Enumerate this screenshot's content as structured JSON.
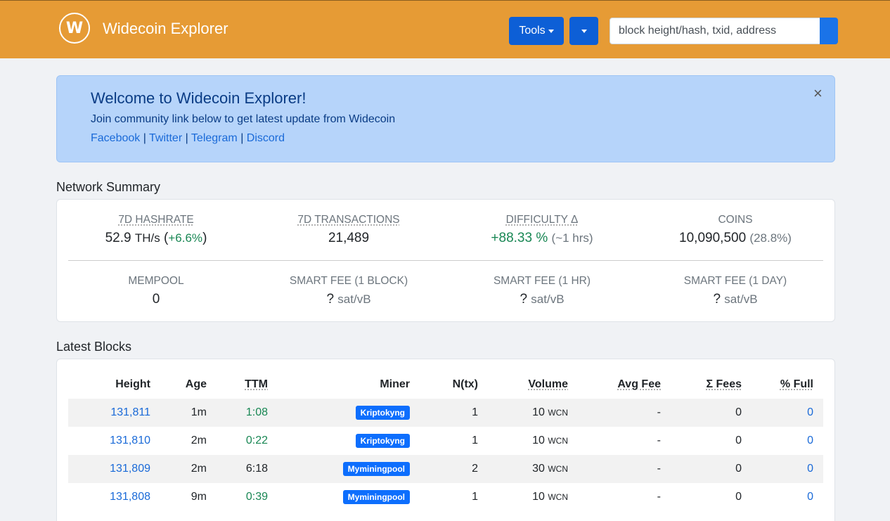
{
  "nav": {
    "logo_letter": "W",
    "brand": "Widecoin Explorer",
    "tools_label": "Tools",
    "search_placeholder": "block height/hash, txid, address"
  },
  "alert": {
    "title": "Welcome to Widecoin Explorer!",
    "text": "Join community link below to get latest update from Widecoin",
    "links": [
      "Facebook",
      "Twitter",
      "Telegram",
      "Discord"
    ],
    "separator": "|",
    "close": "×"
  },
  "network_summary": {
    "title": "Network Summary",
    "hashrate": {
      "label": "7D HASHRATE",
      "value": "52.9",
      "unit": "TH/s",
      "change": "+6.6%"
    },
    "transactions": {
      "label": "7D TRANSACTIONS",
      "value": "21,489"
    },
    "difficulty": {
      "label": "DIFFICULTY Δ",
      "value": "+88.33 %",
      "eta": "(~1 hrs)"
    },
    "coins": {
      "label": "COINS",
      "value": "10,090,500",
      "pct": "(28.8%)"
    },
    "mempool": {
      "label": "MEMPOOL",
      "value": "0"
    },
    "fee_block": {
      "label": "SMART FEE (1 BLOCK)",
      "value": "?",
      "unit": "sat/vB"
    },
    "fee_hr": {
      "label": "SMART FEE (1 HR)",
      "value": "?",
      "unit": "sat/vB"
    },
    "fee_day": {
      "label": "SMART FEE (1 DAY)",
      "value": "?",
      "unit": "sat/vB"
    }
  },
  "latest_blocks": {
    "title": "Latest Blocks",
    "columns": [
      "Height",
      "Age",
      "TTM",
      "Miner",
      "N(tx)",
      "Volume",
      "Avg Fee",
      "Σ Fees",
      "% Full"
    ],
    "rows": [
      {
        "height": "131,811",
        "age": "1m",
        "ttm": "1:08",
        "ttm_green": true,
        "miner": "Kriptokyng",
        "ntx": "1",
        "volume": "10",
        "unit": "WCN",
        "avg_fee": "-",
        "fees": "0",
        "full": "0"
      },
      {
        "height": "131,810",
        "age": "2m",
        "ttm": "0:22",
        "ttm_green": true,
        "miner": "Kriptokyng",
        "ntx": "1",
        "volume": "10",
        "unit": "WCN",
        "avg_fee": "-",
        "fees": "0",
        "full": "0"
      },
      {
        "height": "131,809",
        "age": "2m",
        "ttm": "6:18",
        "ttm_green": false,
        "miner": "Myminingpool",
        "ntx": "2",
        "volume": "30",
        "unit": "WCN",
        "avg_fee": "-",
        "fees": "0",
        "full": "0"
      },
      {
        "height": "131,808",
        "age": "9m",
        "ttm": "0:39",
        "ttm_green": true,
        "miner": "Myminingpool",
        "ntx": "1",
        "volume": "10",
        "unit": "WCN",
        "avg_fee": "-",
        "fees": "0",
        "full": "0"
      }
    ]
  }
}
